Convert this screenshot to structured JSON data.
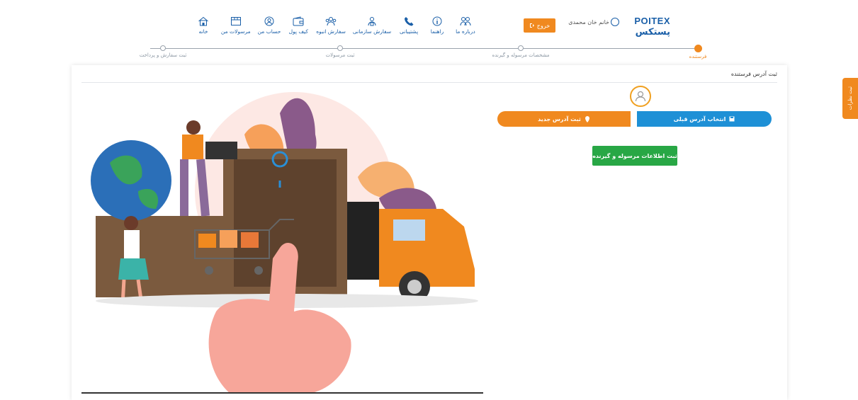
{
  "header": {
    "logo_en": "POITEX",
    "logo_fa": "پستکس",
    "user_name": "خانم خان محمدی",
    "logout_label": "خروج",
    "nav": [
      {
        "name": "about",
        "label": "درباره ما",
        "icon": "people-icon"
      },
      {
        "name": "guide",
        "label": "راهنما",
        "icon": "info-icon"
      },
      {
        "name": "support",
        "label": "پشتیبانی",
        "icon": "phone-icon"
      },
      {
        "name": "org-order",
        "label": "سفارش سازمانی",
        "icon": "building-users-icon"
      },
      {
        "name": "bulk-order",
        "label": "سفارش انبوه",
        "icon": "group-users-icon"
      },
      {
        "name": "wallet",
        "label": "کیف پول",
        "icon": "wallet-icon"
      },
      {
        "name": "account",
        "label": "حساب من",
        "icon": "user-circle-icon"
      },
      {
        "name": "shipments",
        "label": "مرسولات من",
        "icon": "box-icon"
      },
      {
        "name": "home",
        "label": "خانه",
        "icon": "home-icon"
      }
    ]
  },
  "stepper": [
    {
      "label": "فرستنده",
      "active": true
    },
    {
      "label": "مشخصات مرسوله و گیرنده",
      "active": false
    },
    {
      "label": "ثبت مرسولات",
      "active": false
    },
    {
      "label": "ثبت سفارش و پرداخت",
      "active": false
    }
  ],
  "form": {
    "title": "ثبت آدرس فرستنده",
    "prev_address_label": "انتخاب آدرس قبلی",
    "new_address_label": "ثبت آدرس جدید",
    "submit_label": "ثبت اطلاعات مرسوله و گیرنده"
  },
  "feedback_label": "ثبت نظرات",
  "colors": {
    "brand_blue": "#1a5fa8",
    "orange": "#f0891f",
    "blue_button": "#1e90d6",
    "green": "#28a745"
  }
}
